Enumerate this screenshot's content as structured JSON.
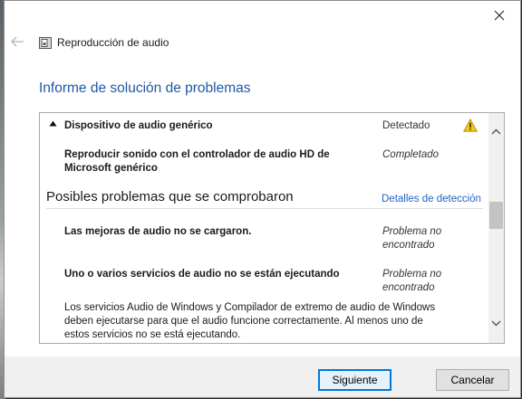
{
  "window": {
    "app_title": "Reproducción de audio",
    "page_title": "Informe de solución de problemas"
  },
  "report": {
    "device": {
      "label": "Dispositivo de audio genérico",
      "status": "Detectado"
    },
    "action": {
      "label": "Reproducir sonido con el controlador de audio HD de Microsoft genérico",
      "status": "Completado"
    },
    "section_title": "Posibles problemas que se comprobaron",
    "detection_link": "Detalles de detección",
    "issues": [
      {
        "label": "Las mejoras de audio no se cargaron.",
        "status": "Problema no encontrado"
      },
      {
        "label": "Uno o varios servicios de audio no se están ejecutando",
        "status": "Problema no encontrado"
      }
    ],
    "description": "Los servicios Audio de Windows y Compilador de extremo de audio de Windows deben ejecutarse para que el audio funcione correctamente. Al menos uno de estos servicios no se está ejecutando."
  },
  "buttons": {
    "next": "Siguiente",
    "cancel": "Cancelar"
  },
  "colors": {
    "title_blue": "#1f57a6",
    "link_blue": "#1f64c4",
    "warning_yellow": "#f2c811",
    "focus_blue": "#0078d7"
  }
}
